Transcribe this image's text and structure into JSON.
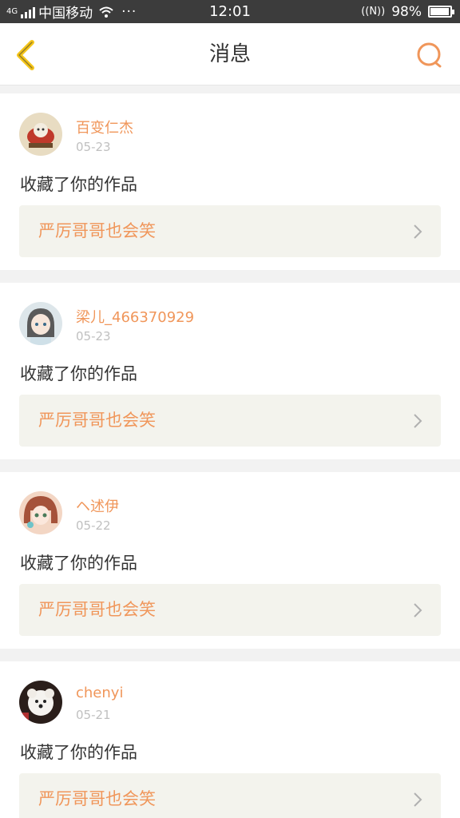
{
  "status_bar": {
    "carrier": "中国移动",
    "dots": "···",
    "time": "12:01",
    "nfc": "((N))",
    "battery": "98%",
    "network_label": "4G"
  },
  "nav": {
    "title": "消息",
    "back_icon": "chevron-left-icon",
    "search_icon": "search-icon",
    "accent": "#f0965a",
    "back_color": "#f5c518"
  },
  "messages": [
    {
      "user": "百变仁杰",
      "date": "05-23",
      "action": "收藏了你的作品",
      "work": "严厉哥哥也会笑"
    },
    {
      "user": "梁儿_466370929",
      "date": "05-23",
      "action": "收藏了你的作品",
      "work": "严厉哥哥也会笑"
    },
    {
      "user": "ヘ述伊",
      "date": "05-22",
      "action": "收藏了你的作品",
      "work": "严厉哥哥也会笑"
    },
    {
      "user": "chenyi",
      "date": "05-21",
      "action": "收藏了你的作品",
      "work": "严厉哥哥也会笑"
    }
  ]
}
